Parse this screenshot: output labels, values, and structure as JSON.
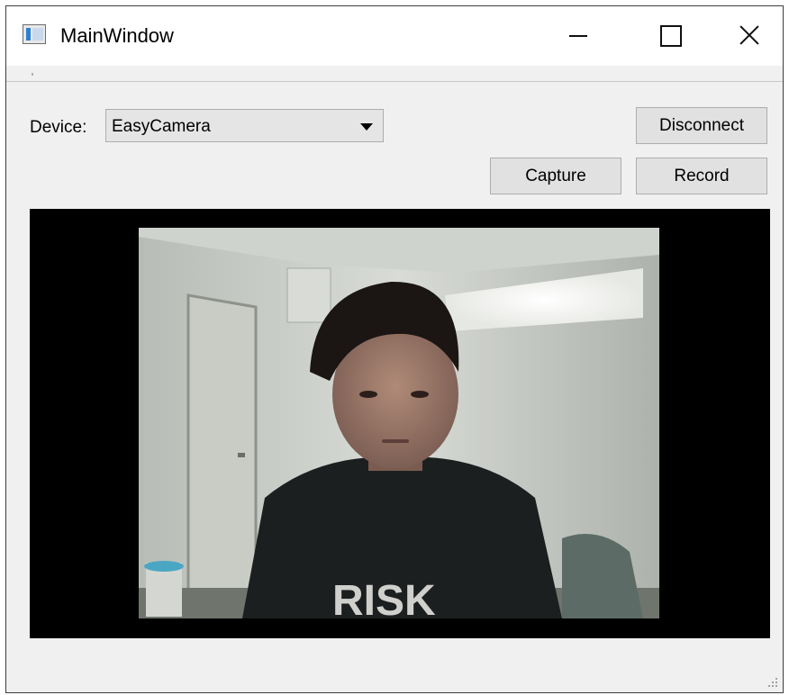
{
  "window": {
    "title": "MainWindow",
    "controls": {
      "minimize_icon": "minimize-icon",
      "maximize_icon": "maximize-icon",
      "close_icon": "close-icon"
    }
  },
  "toolbar": {
    "device_label": "Device:",
    "device_selected": "EasyCamera",
    "disconnect_label": "Disconnect",
    "capture_label": "Capture",
    "record_label": "Record"
  },
  "preview": {
    "content": "live camera feed"
  },
  "colors": {
    "window_bg": "#f0f0f0",
    "titlebar_bg": "#ffffff",
    "button_bg": "#e1e1e1",
    "viewport_bg": "#000000"
  }
}
